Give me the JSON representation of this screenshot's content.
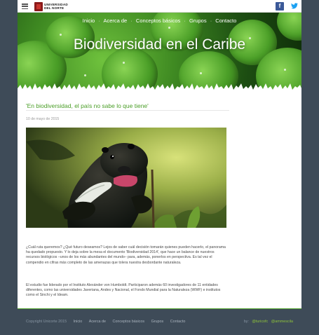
{
  "topbar": {
    "logo_line1": "UNIVERSIDAD",
    "logo_line2": "DEL NORTE",
    "facebook_glyph": "f",
    "twitter_glyph": "t"
  },
  "nav": {
    "items": [
      "Inicio",
      "Acerca de",
      "Conceptos básicos",
      "Grupos",
      "Contacto"
    ],
    "separator": "·"
  },
  "hero": {
    "title": "Biodiversidad en el Caribe"
  },
  "post": {
    "title": "'En biodiversidad, el país no sabe lo que tiene'",
    "date": "10 de mayo de 2015",
    "paragraph1": "¿Cuál ruta queremos? ¿Qué futuro deseamos? Lejos de saber cuál decisión tomarán quienes pueden hacerlo, el panorama ha quedado propuesto. Y lo deja sobre la mesa el documento 'Biodiversidad 2014', que hace un balance de nuestros recursos biológicos –unos de los más abundantes del mundo– para, además, ponerlos en perspectiva. Es tal vez el compendio en cifras más completo de las amenazas que tolera nuestra desbordante naturaleza.",
    "paragraph2": "El estudio fue liderado por el Instituto Alexánder von Humboldt. Participaron además 60 investigadores de 11 entidades diferentes, como las universidades Javeriana, Andes y Nacional, el Fondo Mundial para la Naturaleza (WWF) e institutos como el Sinchi y el Ideam."
  },
  "footer": {
    "copyright": "Copyright Unicorte 2015",
    "links": [
      "Inicio",
      "Acerca de",
      "Conceptos básicos",
      "Grupos",
      "Contacto"
    ],
    "by_label": "by:",
    "author1": "@turicofc",
    "author2": "@ammescila"
  },
  "colors": {
    "accent_green": "#4a9e27",
    "page_bg": "#3e4b58",
    "facebook": "#3b5998",
    "twitter": "#1da1f2"
  }
}
